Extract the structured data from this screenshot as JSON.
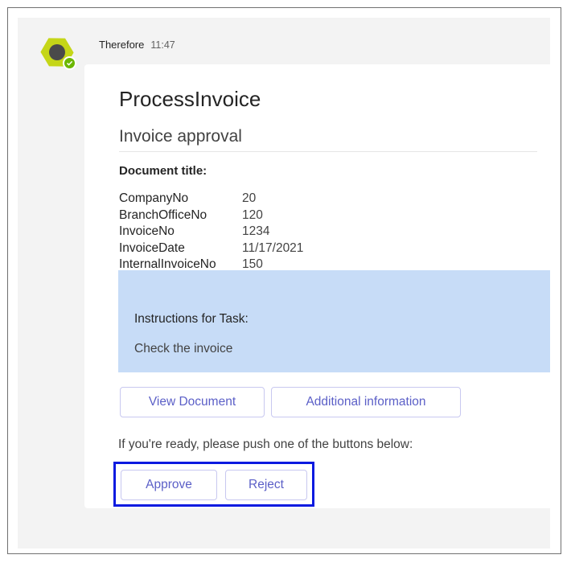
{
  "message": {
    "sender": "Therefore",
    "time": "11:47",
    "avatar_icon": "hexagon-bot-icon",
    "presence_status": "available",
    "brand_color": "#c5d618"
  },
  "card": {
    "title": "ProcessInvoice",
    "subtitle": "Invoice approval",
    "document_title_label": "Document title:",
    "facts": [
      {
        "key": "CompanyNo",
        "value": "20"
      },
      {
        "key": "BranchOfficeNo",
        "value": "120"
      },
      {
        "key": "InvoiceNo",
        "value": "1234"
      },
      {
        "key": "InvoiceDate",
        "value": "11/17/2021"
      },
      {
        "key": "InternalInvoiceNo",
        "value": "150"
      }
    ],
    "instructions": {
      "title": "Instructions for Task:",
      "text": "Check the invoice",
      "background": "#c7dcf7"
    },
    "actions": {
      "view_document": "View Document",
      "additional_information": "Additional information"
    },
    "prompt": "If you're ready, please push one of the buttons below:",
    "decision": {
      "approve": "Approve",
      "reject": "Reject",
      "highlight_color": "#0a1ae0"
    },
    "accent_color": "#5b5fc7"
  }
}
